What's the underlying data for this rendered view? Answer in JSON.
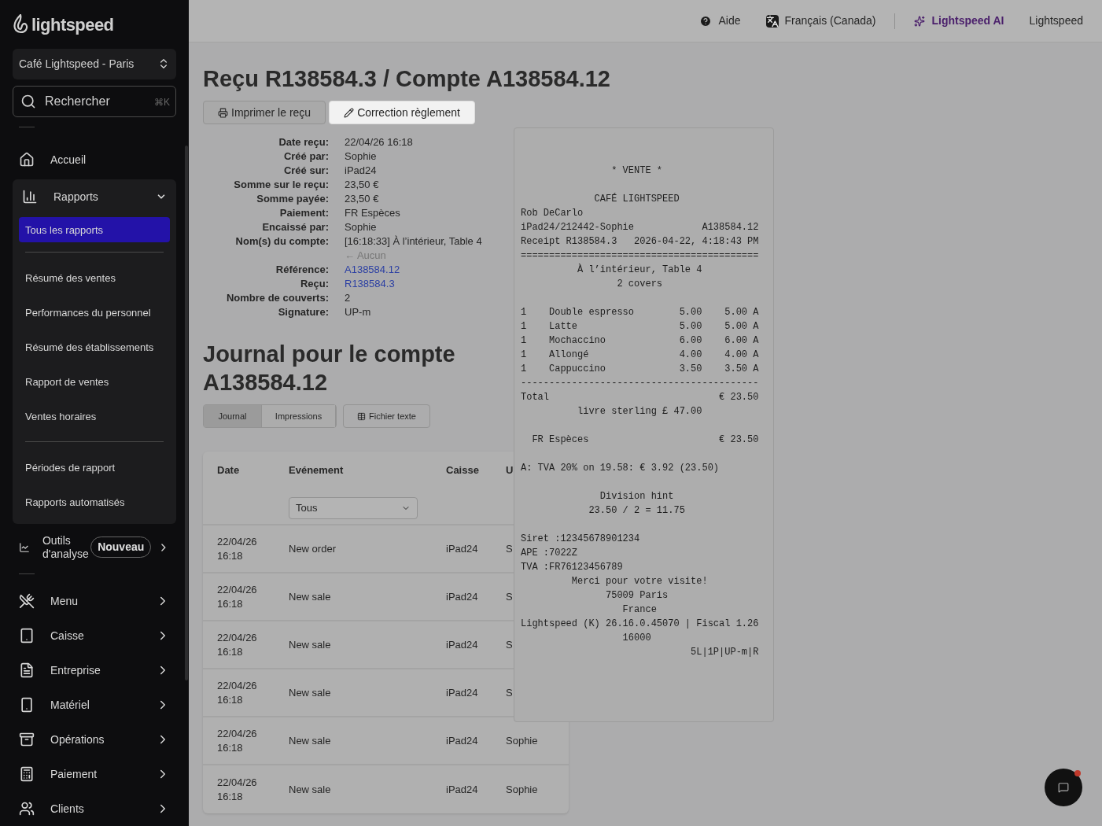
{
  "sidebar": {
    "logo": "lightspeed",
    "store": "Café Lightspeed - Paris",
    "search": {
      "placeholder": "Rechercher",
      "shortcut": "⌘K"
    },
    "home": {
      "label": "Accueil"
    },
    "reports": {
      "label": "Rapports",
      "expanded": true,
      "groups": [
        {
          "items": [
            {
              "label": "Tous les rapports",
              "selected": true
            }
          ]
        },
        {
          "items": [
            {
              "label": "Résumé des ventes",
              "selected": false
            },
            {
              "label": "Performances du personnel",
              "selected": false
            },
            {
              "label": "Résumé des établissements",
              "selected": false
            },
            {
              "label": "Rapport de ventes",
              "selected": false
            },
            {
              "label": "Ventes horaires",
              "selected": false
            }
          ]
        },
        {
          "items": [
            {
              "label": "Périodes de rapport",
              "selected": false
            },
            {
              "label": "Rapports automatisés",
              "selected": false
            }
          ]
        }
      ]
    },
    "analytics": {
      "label": "Outils d'analyse",
      "badge": "Nouveau"
    },
    "items": [
      {
        "label": "Menu"
      },
      {
        "label": "Caisse"
      },
      {
        "label": "Entreprise"
      },
      {
        "label": "Matériel"
      },
      {
        "label": "Opérations"
      },
      {
        "label": "Paiement"
      },
      {
        "label": "Clients"
      }
    ]
  },
  "top_bar": {
    "help": "Aide",
    "language": "Français (Canada)",
    "ai": "Lightspeed AI",
    "account": "Lightspeed"
  },
  "title": "Reçu R138584.3 / Compte A138584.12",
  "actions": [
    {
      "label": "Imprimer le reçu",
      "selected": false
    },
    {
      "label": "Correction règlement",
      "selected": true
    }
  ],
  "details": [
    {
      "label": "Date reçu:",
      "value": "22/04/26 16:18",
      "kind": "text"
    },
    {
      "label": "Créé par:",
      "value": "Sophie",
      "kind": "text"
    },
    {
      "label": "Créé sur:",
      "value": "iPad24",
      "kind": "text"
    },
    {
      "label": "Somme sur le reçu:",
      "value": "23,50 €",
      "kind": "text"
    },
    {
      "label": "Somme payée:",
      "value": "23,50 €",
      "kind": "text"
    },
    {
      "label": "Paiement:",
      "value": "FR Espèces",
      "kind": "text"
    },
    {
      "label": "Encaissé par:",
      "value": "Sophie",
      "kind": "text"
    },
    {
      "label": "Nom(s) du compte:",
      "value": "[16:18:33] À l’intérieur, Table 4",
      "note": "← Aucun",
      "kind": "text"
    },
    {
      "label": "Référence:",
      "value": "A138584.12",
      "kind": "link"
    },
    {
      "label": "Reçu:",
      "value": "R138584.3",
      "kind": "link"
    },
    {
      "label": "Nombre de couverts:",
      "value": "2",
      "kind": "text"
    },
    {
      "label": "Signature:",
      "value": "UP-m",
      "kind": "text"
    }
  ],
  "journal": {
    "title": "Journal pour le compte A138584.12",
    "tabs": [
      {
        "label": "Journal",
        "selected": true
      },
      {
        "label": "Impressions",
        "selected": false
      }
    ],
    "export": "Fichier texte",
    "table": {
      "columns": [
        "Date",
        "Evénement",
        "Caisse",
        "U"
      ],
      "filter": {
        "value": "Tous"
      },
      "rows": [
        {
          "date": "22/04/26",
          "time": "16:18",
          "event": "New order",
          "register": "iPad24",
          "user": "S"
        },
        {
          "date": "22/04/26",
          "time": "16:18",
          "event": "New sale",
          "register": "iPad24",
          "user": "S"
        },
        {
          "date": "22/04/26",
          "time": "16:18",
          "event": "New sale",
          "register": "iPad24",
          "user": "S"
        },
        {
          "date": "22/04/26",
          "time": "16:18",
          "event": "New sale",
          "register": "iPad24",
          "user": "S"
        },
        {
          "date": "22/04/26",
          "time": "16:18",
          "event": "New sale",
          "register": "iPad24",
          "user": "Sophie"
        },
        {
          "date": "22/04/26",
          "time": "16:18",
          "event": "New sale",
          "register": "iPad24",
          "user": "Sophie"
        }
      ]
    }
  },
  "receipt": {
    "lines": [
      {
        "kind": "text",
        "text": "                * VENTE *"
      },
      {
        "kind": "gap"
      },
      {
        "kind": "text",
        "text": "             CAFÉ LIGHTSPEED"
      },
      {
        "kind": "text",
        "text": "Rob DeCarlo"
      },
      {
        "kind": "text",
        "text": "iPad24/212442-Sophie            A138584.12"
      },
      {
        "kind": "text",
        "text": "Receipt R138584.3   2026-04-22, 4:18:43 PM"
      },
      {
        "kind": "text",
        "text": "=========================================="
      },
      {
        "kind": "text",
        "text": "          À l’intérieur, Table 4"
      },
      {
        "kind": "text",
        "text": "                 2 covers"
      },
      {
        "kind": "gap"
      },
      {
        "kind": "text",
        "text": "1    Double espresso        5.00    5.00 A"
      },
      {
        "kind": "text",
        "text": "1    Latte                  5.00    5.00 A"
      },
      {
        "kind": "text",
        "text": "1    Mochaccino             6.00    6.00 A"
      },
      {
        "kind": "text",
        "text": "1    Allongé                4.00    4.00 A"
      },
      {
        "kind": "text",
        "text": "1    Cappuccino             3.50    3.50 A"
      },
      {
        "kind": "text",
        "text": "------------------------------------------"
      },
      {
        "kind": "text",
        "text": "Total                              € 23.50"
      },
      {
        "kind": "text",
        "text": "          livre sterling £ 47.00"
      },
      {
        "kind": "gap"
      },
      {
        "kind": "text",
        "text": "  FR Espèces                       € 23.50"
      },
      {
        "kind": "gap"
      },
      {
        "kind": "text",
        "text": "A: TVA 20% on 19.58: € 3.92 (23.50)"
      },
      {
        "kind": "gap"
      },
      {
        "kind": "text",
        "text": "              Division hint"
      },
      {
        "kind": "text",
        "text": "            23.50 / 2 = 11.75"
      },
      {
        "kind": "gap"
      },
      {
        "kind": "text",
        "text": "Siret :12345678901234"
      },
      {
        "kind": "text",
        "text": "APE :7022Z"
      },
      {
        "kind": "text",
        "text": "TVA :FR76123456789"
      },
      {
        "kind": "text",
        "text": "         Merci pour votre visite!"
      },
      {
        "kind": "text",
        "text": "               75009 Paris"
      },
      {
        "kind": "text",
        "text": "                  France"
      },
      {
        "kind": "text",
        "text": "Lightspeed (K) 26.16.0.45070 | Fiscal 1.26"
      },
      {
        "kind": "text",
        "text": "                  16000"
      },
      {
        "kind": "text",
        "text": "                              5L|1P|UP-m|R"
      }
    ]
  }
}
